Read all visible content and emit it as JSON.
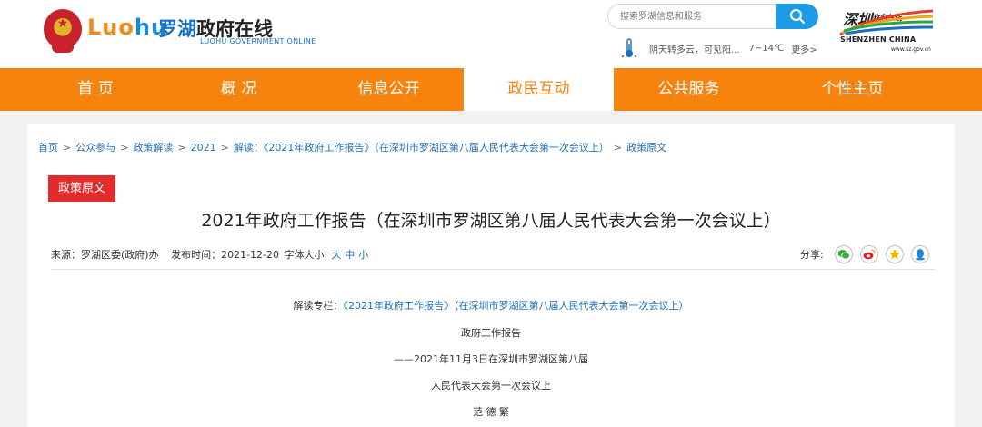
{
  "header": {
    "logo_en_a": "Luo",
    "logo_en_b": "hu",
    "logo_cn_a": "罗湖",
    "logo_cn_b": "政府在线",
    "logo_sub": "LUOHU GOVERNMENT ONLINE",
    "search_placeholder": "搜索罗湖信息和服务",
    "weather_text": "阴天转多云，可见阳...",
    "weather_temp": "7~14℃",
    "weather_more": "更多>",
    "sz_title": "深圳",
    "sz_title2": "政府在线",
    "sz_en": "SHENZHEN CHINA",
    "sz_url": "www.sz.gov.cn"
  },
  "nav": [
    {
      "label": "首 页"
    },
    {
      "label": "概 况"
    },
    {
      "label": "信息公开"
    },
    {
      "label": "政民互动"
    },
    {
      "label": "公共服务"
    },
    {
      "label": "个性主页"
    }
  ],
  "breadcrumb": [
    {
      "label": "首页"
    },
    {
      "label": "公众参与"
    },
    {
      "label": "政策解读"
    },
    {
      "label": "2021"
    },
    {
      "label": "解读：《2021年政府工作报告》（在深圳市罗湖区第八届人民代表大会第一次会议上）"
    },
    {
      "label": "政策原文"
    }
  ],
  "article": {
    "badge": "政策原文",
    "title": "2021年政府工作报告（在深圳市罗湖区第八届人民代表大会第一次会议上）",
    "source_label": "来源：",
    "source": "罗湖区委(政府)办",
    "date_label": "发布时间：",
    "date": "2021-12-20",
    "font_size_label": "字体大小:",
    "font_large": "大",
    "font_medium": "中",
    "font_small": "小",
    "share_label": "分享:",
    "column_label": "解读专栏：",
    "column_link": "《2021年政府工作报告》（在深圳市罗湖区第八届人民代表大会第一次会议上）",
    "line1": "政府工作报告",
    "line2": "——2021年11月3日在深圳市罗湖区第八届",
    "line3": "人民代表大会第一次会议上",
    "line4": "范 德 繁"
  },
  "colors": {
    "nav_bg": "#f7830f",
    "badge_bg": "#e42b2b",
    "link": "#1f6fb8",
    "search_btn": "#1d9be4"
  }
}
